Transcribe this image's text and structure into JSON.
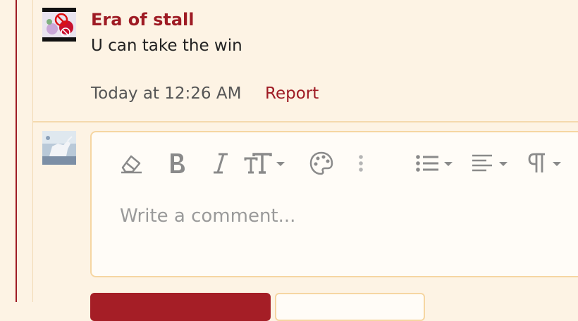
{
  "comment": {
    "author": "Era of stall",
    "body": "U can take the win",
    "timestamp": "Today at 12:26 AM",
    "report_label": "Report"
  },
  "composer": {
    "placeholder": "Write a comment...",
    "toolbar": [
      {
        "name": "clear-formatting-icon",
        "tooltip": "Remove formatting"
      },
      {
        "name": "bold-icon",
        "tooltip": "Bold"
      },
      {
        "name": "italic-icon",
        "tooltip": "Italic"
      },
      {
        "name": "text-size-icon",
        "tooltip": "Font size"
      },
      {
        "name": "palette-icon",
        "tooltip": "Text color"
      },
      {
        "name": "more-options-icon",
        "tooltip": "More options"
      },
      {
        "name": "list-icon",
        "tooltip": "List"
      },
      {
        "name": "align-icon",
        "tooltip": "Alignment"
      },
      {
        "name": "paragraph-icon",
        "tooltip": "Paragraph format"
      }
    ],
    "submit_label": "",
    "secondary_label": ""
  },
  "colors": {
    "accent": "#9e1b24",
    "background": "#fdf3e4",
    "editor_bg": "#fffcf7",
    "editor_border": "#f6d6a2",
    "icon_gray": "#8a8a8a"
  }
}
